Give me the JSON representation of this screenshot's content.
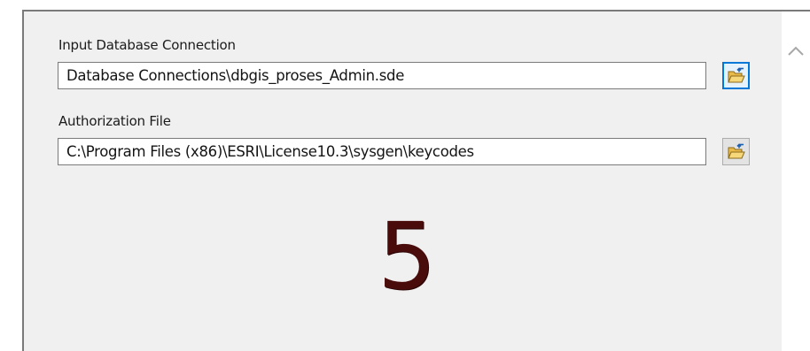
{
  "form": {
    "input_db": {
      "label": "Input Database Connection",
      "value": "Database Connections\\dbgis_proses_Admin.sde"
    },
    "auth_file": {
      "label": "Authorization File",
      "value": "C:\\Program Files (x86)\\ESRI\\License10.3\\sysgen\\keycodes"
    }
  },
  "annotation": {
    "step_number": "5"
  },
  "icons": {
    "browse": "open-folder-icon",
    "scroll": "chevron-up-icon"
  },
  "colors": {
    "panel_bg": "#f0f0f0",
    "focus_border": "#0078d7",
    "step_number": "#4a0b0b"
  }
}
